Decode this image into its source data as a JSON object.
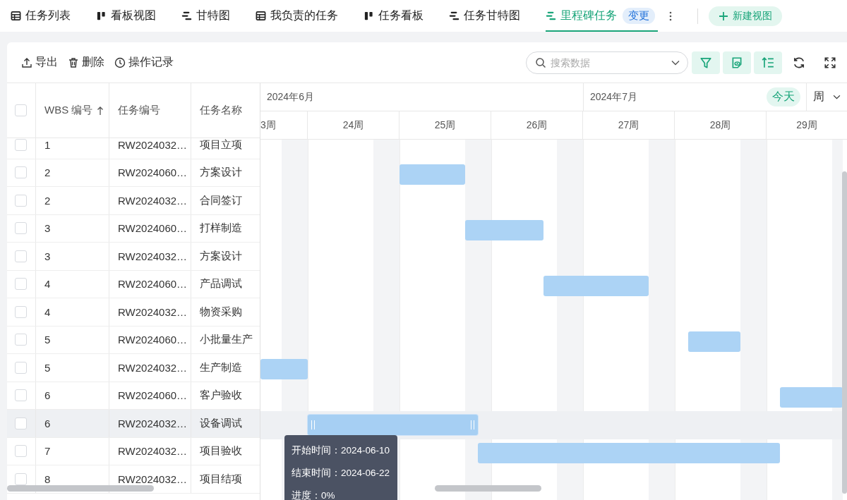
{
  "tabs": [
    {
      "label": "任务列表",
      "kind": "table",
      "selected": false
    },
    {
      "label": "看板视图",
      "kind": "board",
      "selected": false
    },
    {
      "label": "甘特图",
      "kind": "gantt",
      "selected": false
    },
    {
      "label": "我负责的任务",
      "kind": "table",
      "selected": false
    },
    {
      "label": "任务看板",
      "kind": "board",
      "selected": false
    },
    {
      "label": "任务甘特图",
      "kind": "gantt",
      "selected": false
    },
    {
      "label": "里程碑任务",
      "kind": "gantt",
      "selected": true,
      "badge": "变更"
    }
  ],
  "new_view_button": "新建视图",
  "toolbar": {
    "actions": [
      {
        "label": "导出",
        "kind": "export"
      },
      {
        "label": "删除",
        "kind": "trash"
      },
      {
        "label": "操作记录",
        "kind": "clock"
      }
    ],
    "search": {
      "placeholder": "搜索数据"
    }
  },
  "table": {
    "all_checked": false,
    "columns": [
      {
        "label": "WBS 编号",
        "sorted": true
      },
      {
        "label": "任务编号",
        "sorted": false
      },
      {
        "label": "任务名称",
        "sorted": false
      }
    ],
    "rows": [
      {
        "wbs": "1",
        "code": "RW2024032…",
        "name": "项目立项",
        "checked": false,
        "selected": false
      },
      {
        "wbs": "2",
        "code": "RW2024060…",
        "name": "方案设计",
        "checked": false,
        "selected": false
      },
      {
        "wbs": "2",
        "code": "RW2024032…",
        "name": "合同签订",
        "checked": false,
        "selected": false
      },
      {
        "wbs": "3",
        "code": "RW2024060…",
        "name": "打样制造",
        "checked": false,
        "selected": false
      },
      {
        "wbs": "3",
        "code": "RW2024032…",
        "name": "方案设计",
        "checked": false,
        "selected": false
      },
      {
        "wbs": "4",
        "code": "RW2024060…",
        "name": "产品调试",
        "checked": false,
        "selected": false
      },
      {
        "wbs": "4",
        "code": "RW2024032…",
        "name": "物资采购",
        "checked": false,
        "selected": false
      },
      {
        "wbs": "5",
        "code": "RW2024060…",
        "name": "小批量生产",
        "checked": false,
        "selected": false
      },
      {
        "wbs": "5",
        "code": "RW2024032…",
        "name": "生产制造",
        "checked": false,
        "selected": false
      },
      {
        "wbs": "6",
        "code": "RW2024060…",
        "name": "客户验收",
        "checked": false,
        "selected": false
      },
      {
        "wbs": "6",
        "code": "RW2024032…",
        "name": "设备调试",
        "checked": false,
        "selected": true
      },
      {
        "wbs": "7",
        "code": "RW2024032…",
        "name": "项目验收",
        "checked": false,
        "selected": false
      },
      {
        "wbs": "8",
        "code": "RW2024032…",
        "name": "项目结项",
        "checked": false,
        "selected": false
      }
    ]
  },
  "timeline": {
    "months": [
      "2024年6月",
      "2024年7月"
    ],
    "weeks": [
      "3周",
      "24周",
      "25周",
      "26周",
      "27周",
      "28周",
      "29周"
    ],
    "today_button": "今天",
    "scale": "周"
  },
  "tooltip": {
    "lines": [
      "开始时间：2024-06-10",
      "结束时间：2024-06-22",
      "进度：0%"
    ]
  }
}
